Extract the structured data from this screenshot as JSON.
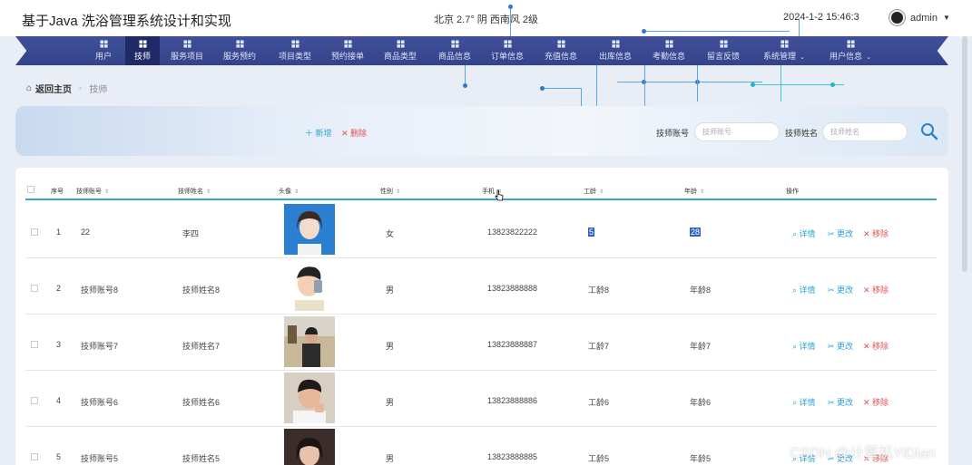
{
  "app": {
    "title": "基于Java 洗浴管理系统设计和实现",
    "weather": "北京  2.7°  阴  西南风  2级",
    "datetime": "2024-1-2 15:46:3",
    "user": "admin"
  },
  "nav": {
    "items": [
      {
        "label": "用户"
      },
      {
        "label": "技师"
      },
      {
        "label": "服务项目"
      },
      {
        "label": "服务预约"
      },
      {
        "label": "项目类型"
      },
      {
        "label": "预约接单"
      },
      {
        "label": "商品类型"
      },
      {
        "label": "商品信息"
      },
      {
        "label": "订单信息"
      },
      {
        "label": "充值信息"
      },
      {
        "label": "出库信息"
      },
      {
        "label": "考勤信息"
      },
      {
        "label": "留言反馈"
      },
      {
        "label": "系统管理"
      },
      {
        "label": "用户信息"
      }
    ],
    "active_index": 1
  },
  "breadcrumb": {
    "home": "返回主页",
    "separator": "-",
    "current": "技师"
  },
  "toolbar": {
    "add_label": "＋ 新增",
    "delete_label": "✕ 删除",
    "account_label": "技师账号",
    "account_placeholder": "技师账号",
    "name_label": "技师姓名",
    "name_placeholder": "技师姓名"
  },
  "table": {
    "columns": [
      "序号",
      "技师账号",
      "技师姓名",
      "头像",
      "性别",
      "手机",
      "工龄",
      "年龄",
      "操作"
    ],
    "actions": {
      "view": "详情",
      "edit": "更改",
      "remove": "移除"
    },
    "rows": [
      {
        "index": "1",
        "account": "22",
        "name": "李四",
        "gender": "女",
        "phone": "13823822222",
        "seniority": "5",
        "age": "28",
        "photo": "girl-portrait"
      },
      {
        "index": "2",
        "account": "技师账号8",
        "name": "技师姓名8",
        "gender": "男",
        "phone": "13823888888",
        "seniority": "工龄8",
        "age": "年龄8",
        "photo": "cartoon-boy"
      },
      {
        "index": "3",
        "account": "技师账号7",
        "name": "技师姓名7",
        "gender": "男",
        "phone": "13823888887",
        "seniority": "工龄7",
        "age": "年龄7",
        "photo": "outdoor-photo"
      },
      {
        "index": "4",
        "account": "技师账号6",
        "name": "技师姓名6",
        "gender": "男",
        "phone": "13823888886",
        "seniority": "工龄6",
        "age": "年龄6",
        "photo": "boy-portrait"
      },
      {
        "index": "5",
        "account": "技师账号5",
        "name": "技师姓名5",
        "gender": "男",
        "phone": "13823888885",
        "seniority": "工龄5",
        "age": "年龄5",
        "photo": "girl-selfie"
      }
    ]
  },
  "watermark": "CSDN @计算机YiDian",
  "colors": {
    "nav_bg": "#3a4a93",
    "nav_active": "#1f2a66",
    "accent": "#2aa3d6",
    "danger": "#e35050",
    "selection": "#2b63c7"
  }
}
